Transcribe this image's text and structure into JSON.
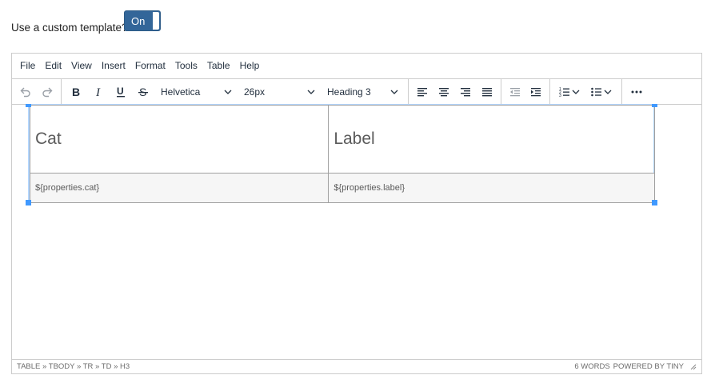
{
  "toggle_row": {
    "label": "Use a custom template?",
    "toggle_text": "On",
    "toggle_on": true,
    "accent_color": "#336699"
  },
  "editor": {
    "menubar": [
      "File",
      "Edit",
      "View",
      "Insert",
      "Format",
      "Tools",
      "Table",
      "Help"
    ],
    "toolbar": {
      "history_icons": [
        "undo-icon",
        "redo-icon"
      ],
      "format_icons": [
        "bold-icon",
        "italic-icon",
        "underline-icon",
        "strikethrough-icon"
      ],
      "font_family": "Helvetica",
      "font_size": "26px",
      "block_format": "Heading 3",
      "align_icons": [
        "align-left-icon",
        "align-center-icon",
        "align-right-icon",
        "align-justify-icon"
      ],
      "indent_icons": [
        "outdent-icon",
        "indent-icon"
      ],
      "list_icons": [
        "numbered-list-icon",
        "bullet-list-icon"
      ],
      "more_icon": "more-icon"
    },
    "content": {
      "table": {
        "header_row": [
          "Cat",
          "Label"
        ],
        "body_row": [
          "${properties.cat}",
          "${properties.label}"
        ]
      }
    },
    "statusbar": {
      "path": "TABLE » TBODY » TR » TD » H3",
      "word_count": "6 WORDS",
      "branding": "POWERED BY TINY"
    },
    "selection_color": "#4099ff"
  }
}
